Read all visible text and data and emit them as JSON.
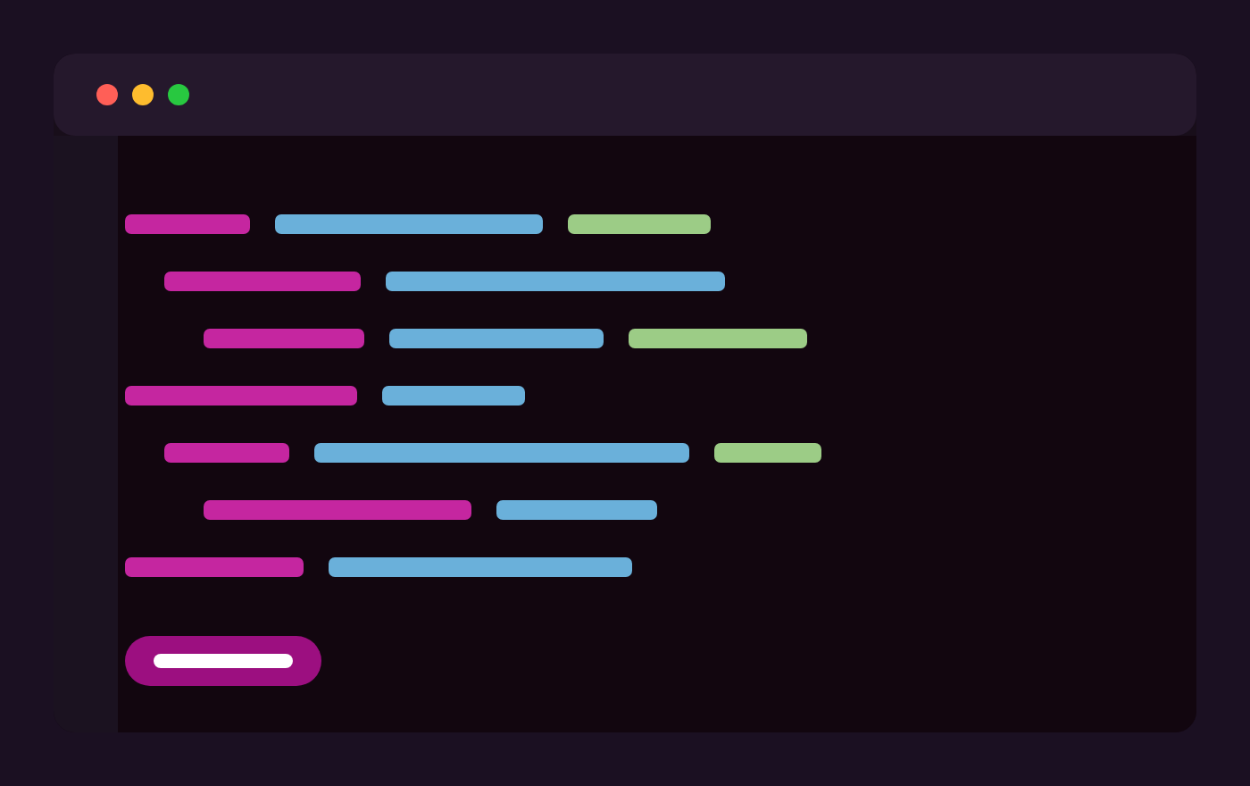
{
  "window": {
    "controls": [
      {
        "color": "#ff5f57"
      },
      {
        "color": "#febc2e"
      },
      {
        "color": "#28c840"
      }
    ]
  },
  "editor": {
    "lines": [
      {
        "tokens": [
          {
            "color": "#c526a0"
          },
          {
            "color": "#6ab0da"
          },
          {
            "color": "#9ccc86"
          }
        ],
        "children": [
          {
            "tokens": [
              {
                "color": "#c526a0"
              },
              {
                "color": "#6ab0da"
              }
            ],
            "children": [
              {
                "tokens": [
                  {
                    "color": "#c526a0"
                  },
                  {
                    "color": "#6ab0da"
                  },
                  {
                    "color": "#9ccc86"
                  }
                ]
              }
            ]
          }
        ]
      },
      {
        "tokens": [
          {
            "color": "#c526a0"
          },
          {
            "color": "#6ab0da"
          }
        ],
        "children": [
          {
            "tokens": [
              {
                "color": "#c526a0"
              },
              {
                "color": "#6ab0da"
              },
              {
                "color": "#9ccc86"
              }
            ],
            "children": [
              {
                "tokens": [
                  {
                    "color": "#c526a0"
                  },
                  {
                    "color": "#6ab0da"
                  }
                ]
              }
            ]
          }
        ]
      },
      {
        "tokens": [
          {
            "color": "#c526a0"
          },
          {
            "color": "#6ab0da"
          }
        ]
      }
    ]
  },
  "action_button": {
    "kind": "filled"
  }
}
